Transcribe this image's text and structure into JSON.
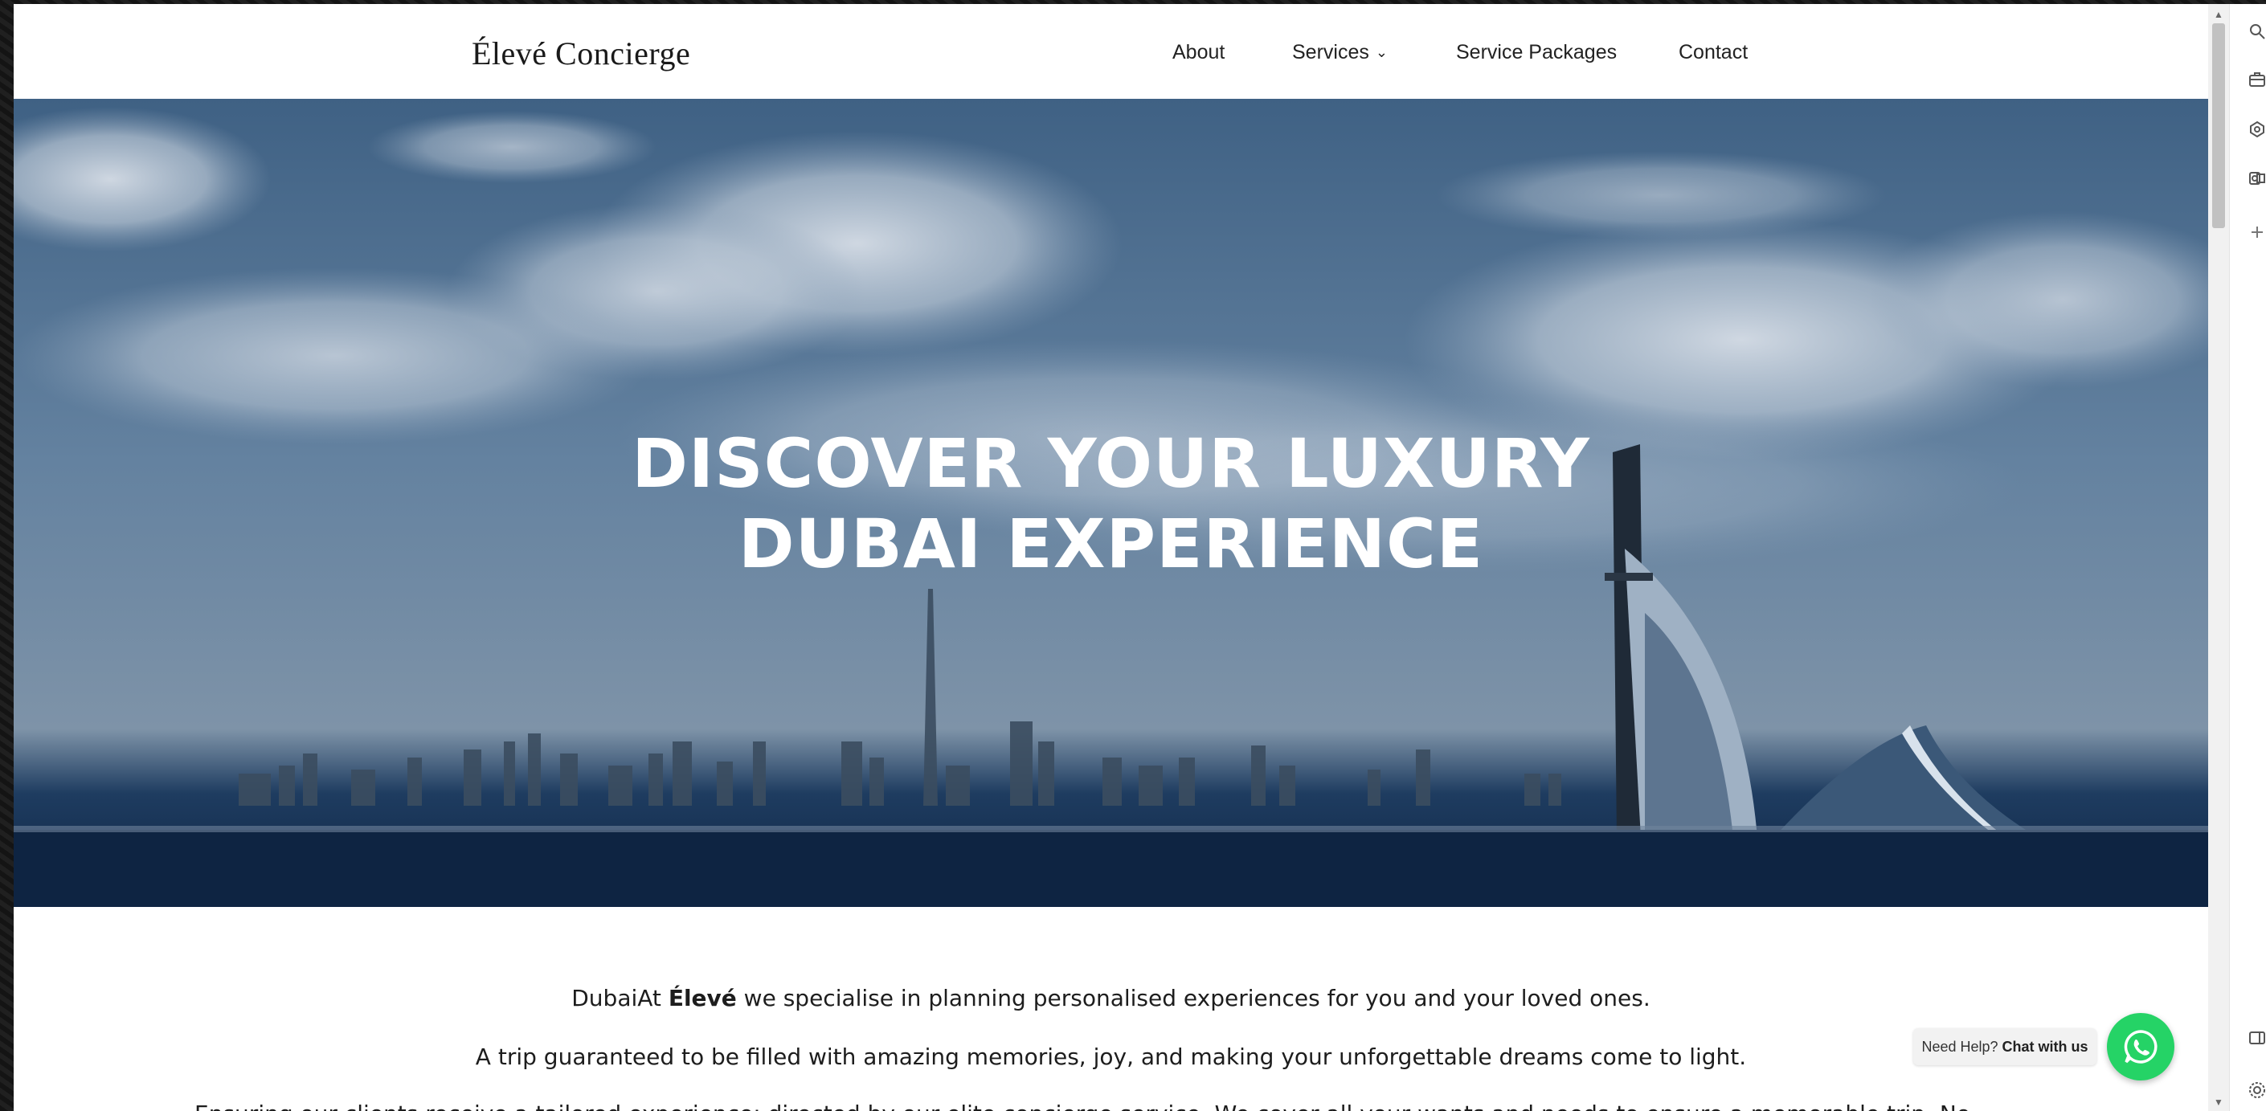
{
  "header": {
    "logo": "Élevé Concierge",
    "nav": {
      "about": "About",
      "services": "Services",
      "packages": "Service Packages",
      "contact": "Contact"
    }
  },
  "hero": {
    "title": "DISCOVER YOUR LUXURY\nDUBAI EXPERIENCE"
  },
  "intro": {
    "line1_prefix": "DubaiAt ",
    "line1_brand": "Élevé",
    "line1_suffix": " we specialise in planning personalised experiences for you and your loved ones.",
    "line2": "A trip guaranteed to be filled with amazing memories, joy, and making your unforgettable dreams come to light.",
    "line3": "Ensuring our clients receive a tailored experience; directed by our elite concierge service. We cover all your wants and needs to ensure a memorable trip. No"
  },
  "chat": {
    "help_prefix": "Need Help? ",
    "help_link": "Chat with us"
  },
  "icons": {
    "services_dropdown": "chevron-down-icon",
    "chat": "whatsapp-icon",
    "rail": [
      "search-icon",
      "briefcase-icon",
      "extension-icon",
      "outlook-icon",
      "plus-icon",
      "sidebar-icon",
      "settings-icon"
    ]
  },
  "colors": {
    "whatsapp": "#25d366",
    "hero_overlay": "#3e5f82",
    "text": "#1d1d1d"
  }
}
